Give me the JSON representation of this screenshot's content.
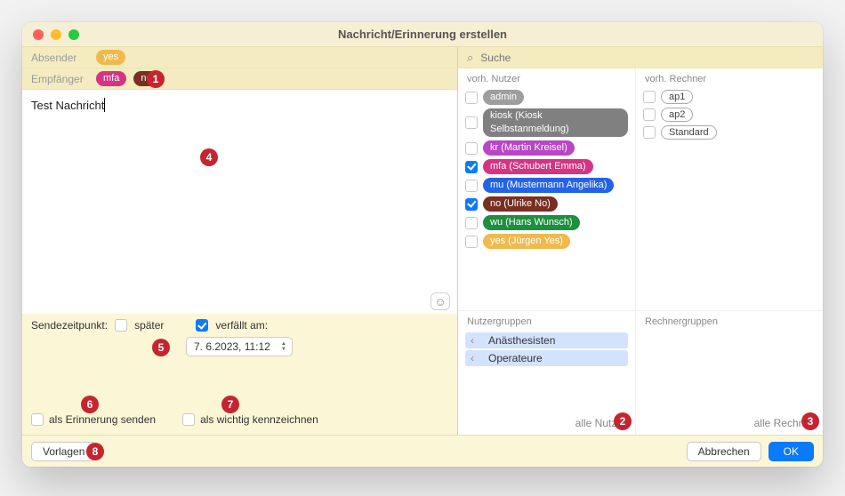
{
  "window": {
    "title": "Nachricht/Erinnerung erstellen"
  },
  "header": {
    "sender_label": "Absender",
    "recipient_label": "Empfänger",
    "sender_pill": "yes",
    "recipient_pills": [
      "mfa",
      "no"
    ]
  },
  "message": {
    "text": "Test Nachricht"
  },
  "options": {
    "send_time_label": "Sendezeitpunkt:",
    "later_label": "später",
    "later_checked": false,
    "expires_label": "verfällt am:",
    "expires_checked": true,
    "expires_value": "7.  6.2023, 11:12",
    "reminder_label": "als Erinnerung senden",
    "reminder_checked": false,
    "important_label": "als wichtig kennzeichnen",
    "important_checked": false
  },
  "footer": {
    "templates": "Vorlagen",
    "cancel": "Abbrechen",
    "ok": "OK"
  },
  "search": {
    "placeholder": "Suche"
  },
  "right": {
    "users_header": "vorh. Nutzer",
    "hosts_header": "vorh. Rechner",
    "users": [
      {
        "label": "admin",
        "color": "gray",
        "checked": false
      },
      {
        "label": "kiosk (Kiosk Selbstanmeldung)",
        "color": "gray2",
        "checked": false
      },
      {
        "label": "kr (Martin Kreisel)",
        "color": "purple",
        "checked": false
      },
      {
        "label": "mfa (Schubert Emma)",
        "color": "magenta",
        "checked": true
      },
      {
        "label": "mu (Mustermann Angelika)",
        "color": "blue",
        "checked": false
      },
      {
        "label": "no (Ulrike No)",
        "color": "maroon",
        "checked": true
      },
      {
        "label": "wu (Hans Wunsch)",
        "color": "green",
        "checked": false
      },
      {
        "label": "yes (Jürgen Yes)",
        "color": "yellow",
        "checked": false
      }
    ],
    "hosts": [
      {
        "label": "ap1",
        "checked": false
      },
      {
        "label": "ap2",
        "checked": false
      },
      {
        "label": "Standard",
        "checked": false
      }
    ],
    "user_groups_header": "Nutzergruppen",
    "host_groups_header": "Rechnergruppen",
    "user_groups": [
      "Anästhesisten",
      "Operateure"
    ],
    "all_users": "alle Nutzer",
    "all_hosts": "alle Rechner"
  },
  "annotations": [
    "1",
    "2",
    "3",
    "4",
    "5",
    "6",
    "7",
    "8"
  ]
}
